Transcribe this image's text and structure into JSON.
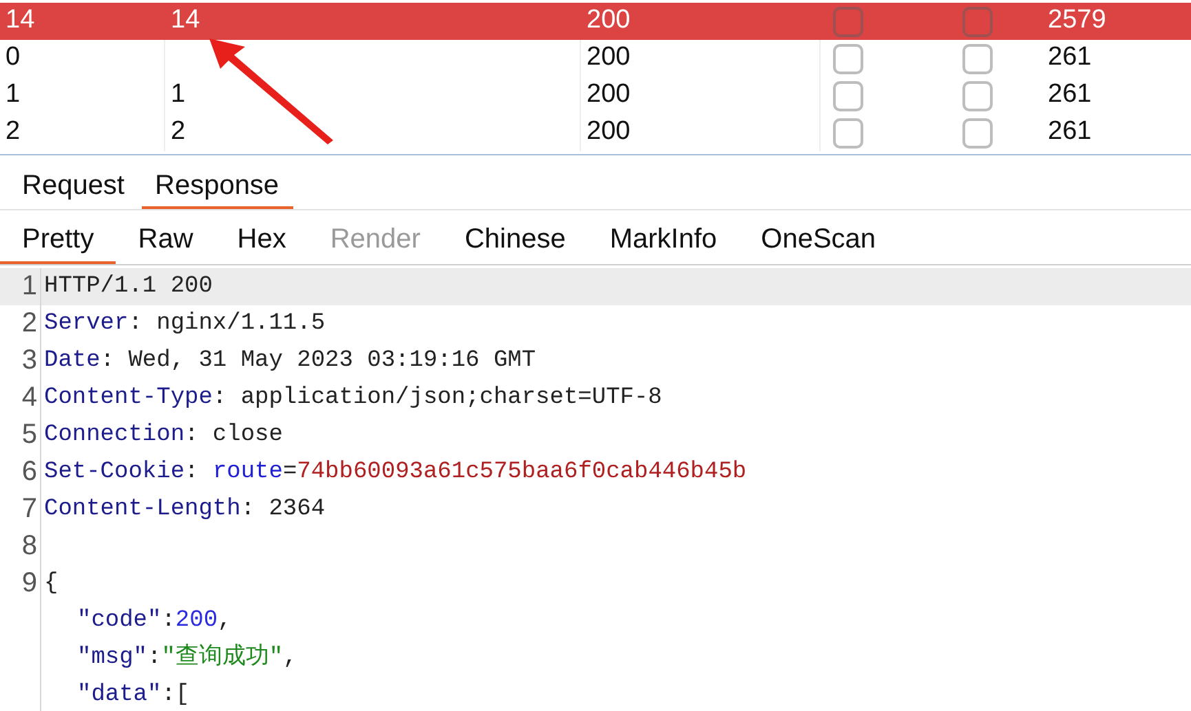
{
  "table": {
    "rows": [
      {
        "selected": true,
        "cells": [
          "14",
          "14",
          "200"
        ],
        "flag_a": {
          "checked": false
        },
        "flag_b": {
          "checked": false
        },
        "length": "2579"
      },
      {
        "selected": false,
        "cells": [
          "0",
          "",
          "200"
        ],
        "flag_a": {
          "checked": false
        },
        "flag_b": {
          "checked": false
        },
        "length": "261"
      },
      {
        "selected": false,
        "cells": [
          "1",
          "1",
          "200"
        ],
        "flag_a": {
          "checked": false
        },
        "flag_b": {
          "checked": false
        },
        "length": "261"
      },
      {
        "selected": false,
        "cells": [
          "2",
          "2",
          "200"
        ],
        "flag_a": {
          "checked": false
        },
        "flag_b": {
          "checked": false
        },
        "length": "261"
      }
    ]
  },
  "message_tabs": [
    {
      "label": "Request",
      "selected": false
    },
    {
      "label": "Response",
      "selected": true
    }
  ],
  "view_tabs": [
    {
      "label": "Pretty",
      "selected": true,
      "disabled": false
    },
    {
      "label": "Raw",
      "selected": false,
      "disabled": false
    },
    {
      "label": "Hex",
      "selected": false,
      "disabled": false
    },
    {
      "label": "Render",
      "selected": false,
      "disabled": true
    },
    {
      "label": "Chinese",
      "selected": false,
      "disabled": false
    },
    {
      "label": "MarkInfo",
      "selected": false,
      "disabled": false
    },
    {
      "label": "OneScan",
      "selected": false,
      "disabled": false
    }
  ],
  "editor": {
    "lines": [
      {
        "number": "1",
        "highlighted": true,
        "segments": [
          {
            "kind": "text",
            "text": "HTTP/1.1 200"
          }
        ]
      },
      {
        "number": "2",
        "highlighted": false,
        "segments": [
          {
            "kind": "key",
            "text": "Server"
          },
          {
            "kind": "text",
            "text": ": nginx/1.11.5"
          }
        ]
      },
      {
        "number": "3",
        "highlighted": false,
        "segments": [
          {
            "kind": "key",
            "text": "Date"
          },
          {
            "kind": "text",
            "text": ": Wed, 31 May 2023 03:19:16 GMT"
          }
        ]
      },
      {
        "number": "4",
        "highlighted": false,
        "segments": [
          {
            "kind": "key",
            "text": "Content-Type"
          },
          {
            "kind": "text",
            "text": ": application/json;charset=UTF-8"
          }
        ]
      },
      {
        "number": "5",
        "highlighted": false,
        "segments": [
          {
            "kind": "key",
            "text": "Connection"
          },
          {
            "kind": "text",
            "text": ": close"
          }
        ]
      },
      {
        "number": "6",
        "highlighted": false,
        "segments": [
          {
            "kind": "key",
            "text": "Set-Cookie"
          },
          {
            "kind": "text",
            "text": ": "
          },
          {
            "kind": "param",
            "text": "route"
          },
          {
            "kind": "text",
            "text": "="
          },
          {
            "kind": "value",
            "text": "74bb60093a61c575baa6f0cab446b45b"
          }
        ]
      },
      {
        "number": "7",
        "highlighted": false,
        "segments": [
          {
            "kind": "key",
            "text": "Content-Length"
          },
          {
            "kind": "text",
            "text": ": 2364"
          }
        ]
      },
      {
        "number": "8",
        "highlighted": false
      },
      {
        "number": "9",
        "highlighted": false,
        "segments": [
          {
            "kind": "text",
            "text": "{"
          }
        ],
        "children": [
          {
            "highlighted": false,
            "segments": [
              {
                "kind": "key",
                "text": "\"code\""
              },
              {
                "kind": "text",
                "text": ":"
              },
              {
                "kind": "number",
                "text": "200"
              },
              {
                "kind": "text",
                "text": ","
              }
            ]
          },
          {
            "highlighted": false,
            "segments": [
              {
                "kind": "key",
                "text": "\"msg\""
              },
              {
                "kind": "text",
                "text": ":"
              },
              {
                "kind": "string",
                "text": "\"查询成功\""
              },
              {
                "kind": "text",
                "text": ","
              }
            ]
          },
          {
            "highlighted": false,
            "segments": [
              {
                "kind": "key",
                "text": "\"data\""
              },
              {
                "kind": "text",
                "text": ":["
              }
            ]
          }
        ]
      }
    ]
  }
}
